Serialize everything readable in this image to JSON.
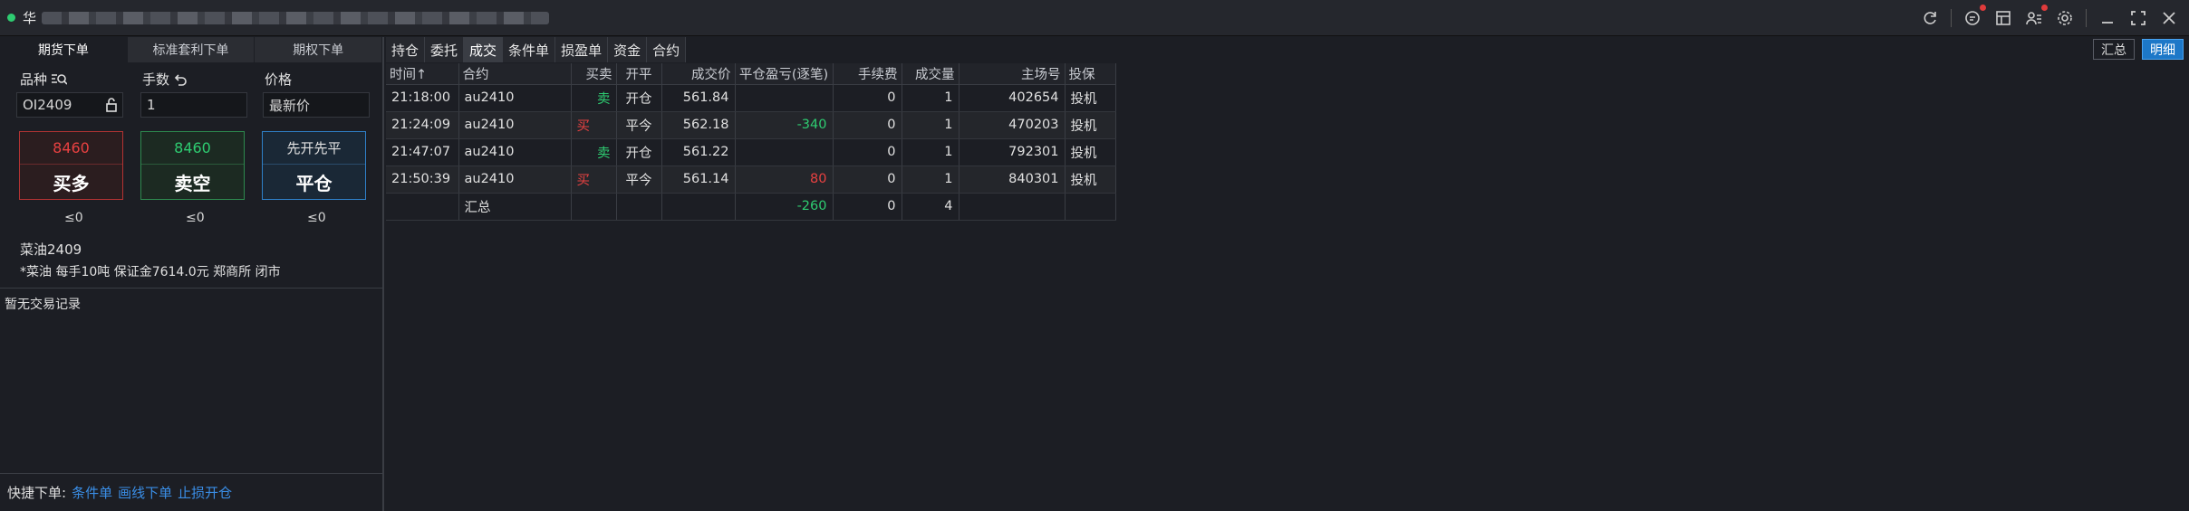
{
  "titlebar": {
    "app_title": "华"
  },
  "left": {
    "tabs": [
      "期货下单",
      "标准套利下单",
      "期权下单"
    ],
    "labels": {
      "variety": "品种",
      "qty": "手数",
      "price": "价格"
    },
    "variety_value": "OI2409",
    "qty_value": "1",
    "price_value": "最新价",
    "buy": {
      "price": "8460",
      "label": "买多",
      "limit": "≤0"
    },
    "sell": {
      "price": "8460",
      "label": "卖空",
      "limit": "≤0"
    },
    "close": {
      "price": "先开先平",
      "label": "平仓",
      "limit": "≤0"
    },
    "contract_name": "菜油2409",
    "contract_info": "*菜油 每手10吨 保证金7614.0元 郑商所 闭市",
    "no_records": "暂无交易记录",
    "quick_label": "快捷下单:",
    "quick_links": [
      "条件单",
      "画线下单",
      "止损开仓"
    ]
  },
  "right": {
    "tabs": [
      "持仓",
      "委托",
      "成交",
      "条件单",
      "损盈单",
      "资金",
      "合约"
    ],
    "active_tab": "成交",
    "view_buttons": [
      "汇总",
      "明细"
    ],
    "columns": [
      "时间↑",
      "合约",
      "买卖",
      "开平",
      "成交价",
      "平仓盈亏(逐笔)",
      "手续费",
      "成交量",
      "主场号",
      "投保"
    ],
    "rows": [
      {
        "time": "21:18:00",
        "contract": "au2410",
        "side": "卖",
        "oc": "开仓",
        "price": "561.84",
        "pnl": "",
        "fee": "0",
        "vol": "1",
        "id": "402654",
        "hedge": "投机"
      },
      {
        "time": "21:24:09",
        "contract": "au2410",
        "side": "买",
        "oc": "平今",
        "price": "562.18",
        "pnl": "-340",
        "fee": "0",
        "vol": "1",
        "id": "470203",
        "hedge": "投机"
      },
      {
        "time": "21:47:07",
        "contract": "au2410",
        "side": "卖",
        "oc": "开仓",
        "price": "561.22",
        "pnl": "",
        "fee": "0",
        "vol": "1",
        "id": "792301",
        "hedge": "投机"
      },
      {
        "time": "21:50:39",
        "contract": "au2410",
        "side": "买",
        "oc": "平今",
        "price": "561.14",
        "pnl": "80",
        "fee": "0",
        "vol": "1",
        "id": "840301",
        "hedge": "投机"
      }
    ],
    "summary": {
      "label": "汇总",
      "pnl": "-260",
      "fee": "0",
      "vol": "4"
    }
  },
  "colors": {
    "buy": "#e84141",
    "sell": "#2ecc71",
    "accent": "#1d78c8"
  }
}
